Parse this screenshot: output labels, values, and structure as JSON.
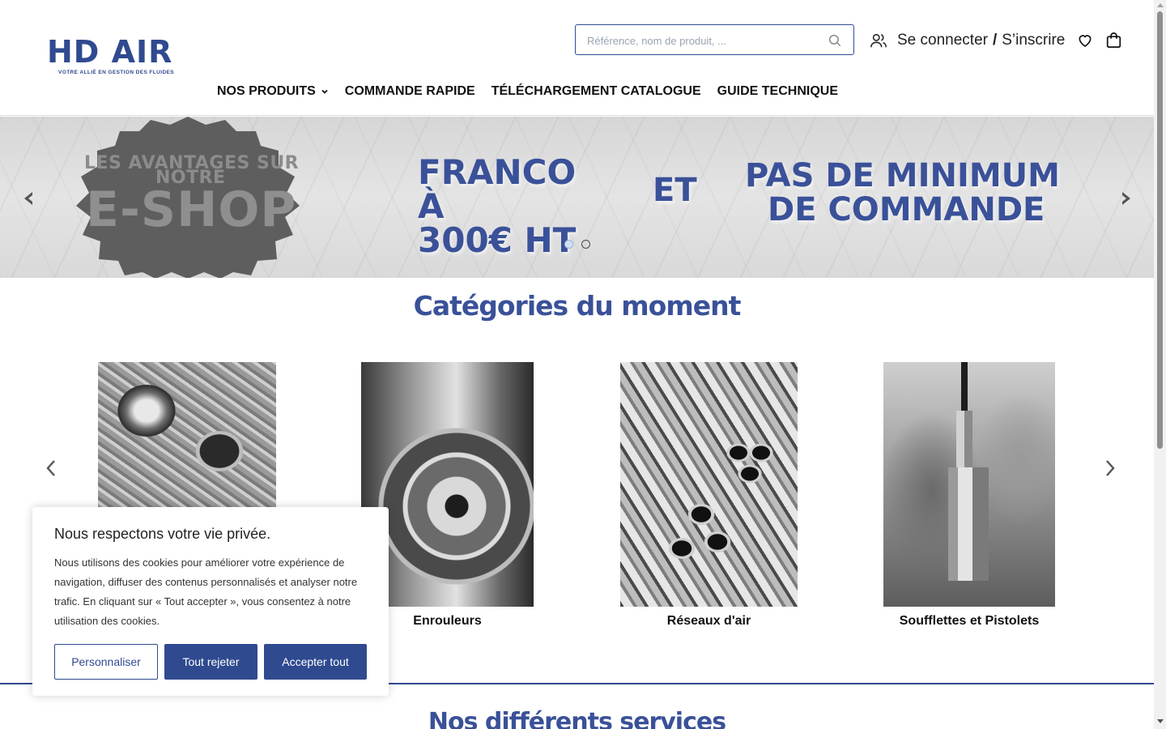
{
  "header": {
    "logo": {
      "name": "HD AIR",
      "tagline": "VOTRE ALLIÉ EN GESTION DES FLUIDES"
    },
    "search": {
      "placeholder": "Référence, nom de produit, ...",
      "value": ""
    },
    "account": {
      "login": "Se connecter",
      "separator": "/",
      "register": "S’inscrire"
    },
    "icons": [
      "search-icon",
      "user-icon",
      "heart-icon",
      "shopping-bag-icon",
      "chevron-down-icon"
    ],
    "nav": [
      {
        "label": "NOS PRODUITS",
        "has_dropdown": true
      },
      {
        "label": "COMMANDE RAPIDE"
      },
      {
        "label": "TÉLÉCHARGEMENT CATALOGUE"
      },
      {
        "label": "GUIDE TECHNIQUE"
      }
    ]
  },
  "banner": {
    "badge": {
      "line1": "LES AVANTAGES SUR",
      "line2": "NOTRE",
      "line3": "E-SHOP"
    },
    "franco": {
      "line1": "FRANCO À",
      "line2": "300€ HT"
    },
    "et": "ET",
    "minimum": {
      "line1": "PAS DE MINIMUM",
      "line2": "DE COMMANDE"
    },
    "slides_total": 2,
    "active_slide": 1
  },
  "categories": {
    "title": "Catégories du moment",
    "items": [
      {
        "label": ""
      },
      {
        "label": "Enrouleurs"
      },
      {
        "label": "Réseaux d'air"
      },
      {
        "label": "Soufflettes et Pistolets"
      }
    ]
  },
  "services": {
    "title": "Nos différents services"
  },
  "cookie": {
    "title": "Nous respectons votre vie privée.",
    "body": "Nous utilisons des cookies pour améliorer votre expérience de navigation, diffuser des contenus personnalisés et analyser notre trafic. En cliquant sur « Tout accepter », vous consentez à notre utilisation des cookies.",
    "buttons": {
      "customize": "Personnaliser",
      "reject": "Tout rejeter",
      "accept": "Accepter tout"
    }
  },
  "colors": {
    "brand": "#2f4a8f",
    "heading": "#3a5199",
    "banner_bg": "#dedede"
  }
}
